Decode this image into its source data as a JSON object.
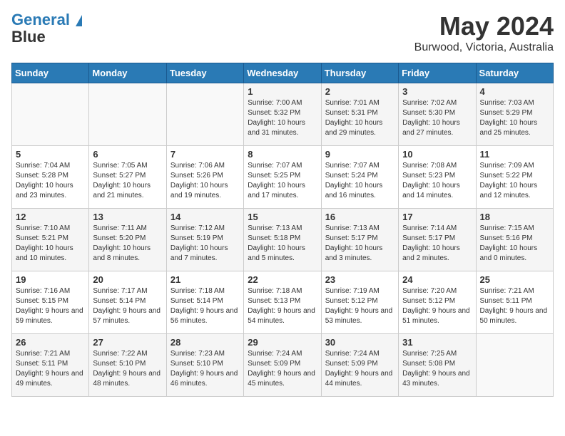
{
  "header": {
    "logo_line1": "General",
    "logo_line2": "Blue",
    "month": "May 2024",
    "location": "Burwood, Victoria, Australia"
  },
  "weekdays": [
    "Sunday",
    "Monday",
    "Tuesday",
    "Wednesday",
    "Thursday",
    "Friday",
    "Saturday"
  ],
  "weeks": [
    [
      {
        "day": "",
        "sunrise": "",
        "sunset": "",
        "daylight": ""
      },
      {
        "day": "",
        "sunrise": "",
        "sunset": "",
        "daylight": ""
      },
      {
        "day": "",
        "sunrise": "",
        "sunset": "",
        "daylight": ""
      },
      {
        "day": "1",
        "sunrise": "Sunrise: 7:00 AM",
        "sunset": "Sunset: 5:32 PM",
        "daylight": "Daylight: 10 hours and 31 minutes."
      },
      {
        "day": "2",
        "sunrise": "Sunrise: 7:01 AM",
        "sunset": "Sunset: 5:31 PM",
        "daylight": "Daylight: 10 hours and 29 minutes."
      },
      {
        "day": "3",
        "sunrise": "Sunrise: 7:02 AM",
        "sunset": "Sunset: 5:30 PM",
        "daylight": "Daylight: 10 hours and 27 minutes."
      },
      {
        "day": "4",
        "sunrise": "Sunrise: 7:03 AM",
        "sunset": "Sunset: 5:29 PM",
        "daylight": "Daylight: 10 hours and 25 minutes."
      }
    ],
    [
      {
        "day": "5",
        "sunrise": "Sunrise: 7:04 AM",
        "sunset": "Sunset: 5:28 PM",
        "daylight": "Daylight: 10 hours and 23 minutes."
      },
      {
        "day": "6",
        "sunrise": "Sunrise: 7:05 AM",
        "sunset": "Sunset: 5:27 PM",
        "daylight": "Daylight: 10 hours and 21 minutes."
      },
      {
        "day": "7",
        "sunrise": "Sunrise: 7:06 AM",
        "sunset": "Sunset: 5:26 PM",
        "daylight": "Daylight: 10 hours and 19 minutes."
      },
      {
        "day": "8",
        "sunrise": "Sunrise: 7:07 AM",
        "sunset": "Sunset: 5:25 PM",
        "daylight": "Daylight: 10 hours and 17 minutes."
      },
      {
        "day": "9",
        "sunrise": "Sunrise: 7:07 AM",
        "sunset": "Sunset: 5:24 PM",
        "daylight": "Daylight: 10 hours and 16 minutes."
      },
      {
        "day": "10",
        "sunrise": "Sunrise: 7:08 AM",
        "sunset": "Sunset: 5:23 PM",
        "daylight": "Daylight: 10 hours and 14 minutes."
      },
      {
        "day": "11",
        "sunrise": "Sunrise: 7:09 AM",
        "sunset": "Sunset: 5:22 PM",
        "daylight": "Daylight: 10 hours and 12 minutes."
      }
    ],
    [
      {
        "day": "12",
        "sunrise": "Sunrise: 7:10 AM",
        "sunset": "Sunset: 5:21 PM",
        "daylight": "Daylight: 10 hours and 10 minutes."
      },
      {
        "day": "13",
        "sunrise": "Sunrise: 7:11 AM",
        "sunset": "Sunset: 5:20 PM",
        "daylight": "Daylight: 10 hours and 8 minutes."
      },
      {
        "day": "14",
        "sunrise": "Sunrise: 7:12 AM",
        "sunset": "Sunset: 5:19 PM",
        "daylight": "Daylight: 10 hours and 7 minutes."
      },
      {
        "day": "15",
        "sunrise": "Sunrise: 7:13 AM",
        "sunset": "Sunset: 5:18 PM",
        "daylight": "Daylight: 10 hours and 5 minutes."
      },
      {
        "day": "16",
        "sunrise": "Sunrise: 7:13 AM",
        "sunset": "Sunset: 5:17 PM",
        "daylight": "Daylight: 10 hours and 3 minutes."
      },
      {
        "day": "17",
        "sunrise": "Sunrise: 7:14 AM",
        "sunset": "Sunset: 5:17 PM",
        "daylight": "Daylight: 10 hours and 2 minutes."
      },
      {
        "day": "18",
        "sunrise": "Sunrise: 7:15 AM",
        "sunset": "Sunset: 5:16 PM",
        "daylight": "Daylight: 10 hours and 0 minutes."
      }
    ],
    [
      {
        "day": "19",
        "sunrise": "Sunrise: 7:16 AM",
        "sunset": "Sunset: 5:15 PM",
        "daylight": "Daylight: 9 hours and 59 minutes."
      },
      {
        "day": "20",
        "sunrise": "Sunrise: 7:17 AM",
        "sunset": "Sunset: 5:14 PM",
        "daylight": "Daylight: 9 hours and 57 minutes."
      },
      {
        "day": "21",
        "sunrise": "Sunrise: 7:18 AM",
        "sunset": "Sunset: 5:14 PM",
        "daylight": "Daylight: 9 hours and 56 minutes."
      },
      {
        "day": "22",
        "sunrise": "Sunrise: 7:18 AM",
        "sunset": "Sunset: 5:13 PM",
        "daylight": "Daylight: 9 hours and 54 minutes."
      },
      {
        "day": "23",
        "sunrise": "Sunrise: 7:19 AM",
        "sunset": "Sunset: 5:12 PM",
        "daylight": "Daylight: 9 hours and 53 minutes."
      },
      {
        "day": "24",
        "sunrise": "Sunrise: 7:20 AM",
        "sunset": "Sunset: 5:12 PM",
        "daylight": "Daylight: 9 hours and 51 minutes."
      },
      {
        "day": "25",
        "sunrise": "Sunrise: 7:21 AM",
        "sunset": "Sunset: 5:11 PM",
        "daylight": "Daylight: 9 hours and 50 minutes."
      }
    ],
    [
      {
        "day": "26",
        "sunrise": "Sunrise: 7:21 AM",
        "sunset": "Sunset: 5:11 PM",
        "daylight": "Daylight: 9 hours and 49 minutes."
      },
      {
        "day": "27",
        "sunrise": "Sunrise: 7:22 AM",
        "sunset": "Sunset: 5:10 PM",
        "daylight": "Daylight: 9 hours and 48 minutes."
      },
      {
        "day": "28",
        "sunrise": "Sunrise: 7:23 AM",
        "sunset": "Sunset: 5:10 PM",
        "daylight": "Daylight: 9 hours and 46 minutes."
      },
      {
        "day": "29",
        "sunrise": "Sunrise: 7:24 AM",
        "sunset": "Sunset: 5:09 PM",
        "daylight": "Daylight: 9 hours and 45 minutes."
      },
      {
        "day": "30",
        "sunrise": "Sunrise: 7:24 AM",
        "sunset": "Sunset: 5:09 PM",
        "daylight": "Daylight: 9 hours and 44 minutes."
      },
      {
        "day": "31",
        "sunrise": "Sunrise: 7:25 AM",
        "sunset": "Sunset: 5:08 PM",
        "daylight": "Daylight: 9 hours and 43 minutes."
      },
      {
        "day": "",
        "sunrise": "",
        "sunset": "",
        "daylight": ""
      }
    ]
  ]
}
